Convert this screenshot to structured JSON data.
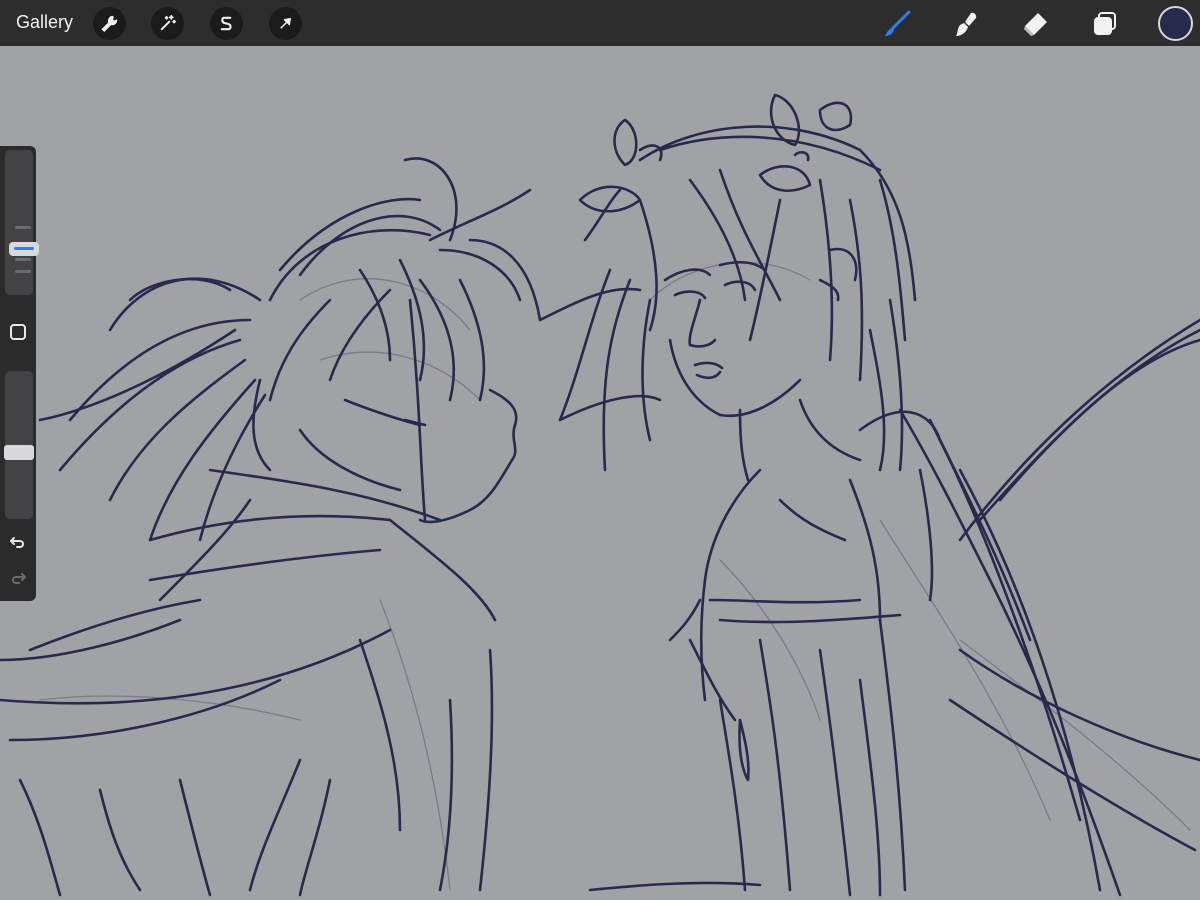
{
  "topbar": {
    "gallery_label": "Gallery",
    "left_tools": [
      {
        "icon": "wrench-icon",
        "name": "actions"
      },
      {
        "icon": "magic-wand-icon",
        "name": "adjustments"
      },
      {
        "icon": "selection-s-icon",
        "name": "selection"
      },
      {
        "icon": "arrow-cursor-icon",
        "name": "transform"
      }
    ],
    "right_tools": [
      {
        "icon": "brush-icon",
        "name": "paint",
        "active": true
      },
      {
        "icon": "smudge-icon",
        "name": "smudge",
        "active": false
      },
      {
        "icon": "eraser-icon",
        "name": "erase",
        "active": false
      },
      {
        "icon": "layers-icon",
        "name": "layers",
        "active": false
      }
    ],
    "active_tool_color": "#2f7df6",
    "current_color": "#272a4d"
  },
  "sidebar": {
    "brush_size_level": 0.63,
    "brush_opacity_level": 0.5,
    "modify_icon": "square-icon",
    "undo_icon": "undo-arrow-icon",
    "redo_icon": "redo-arrow-icon"
  },
  "canvas": {
    "background_color": "#a1a2a6",
    "ink_color": "#272a4d",
    "content": "sketch-two-figures"
  }
}
